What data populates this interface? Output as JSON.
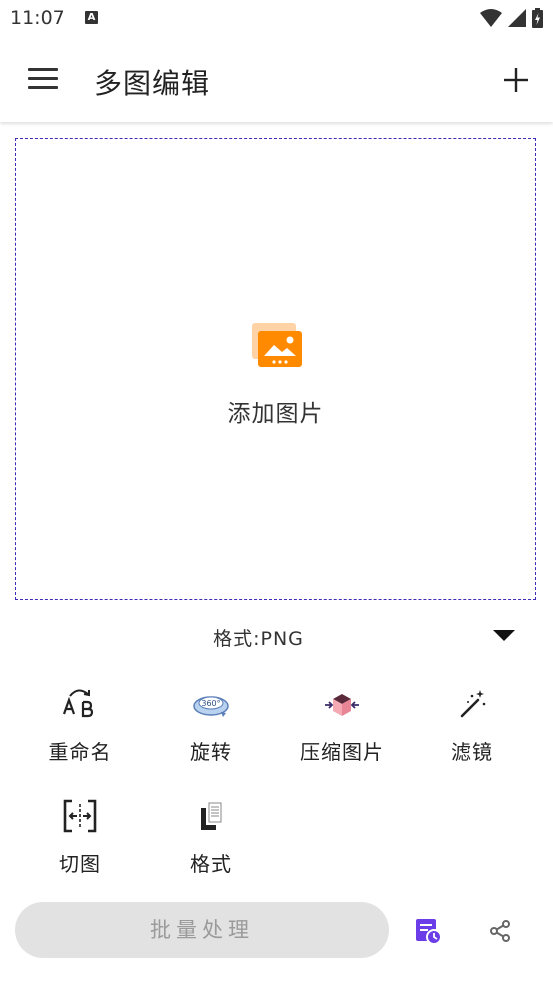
{
  "status_bar": {
    "time": "11:07",
    "notification_icon": "A"
  },
  "app_bar": {
    "title": "多图编辑",
    "menu_icon": "hamburger-menu-icon",
    "add_icon": "plus-icon"
  },
  "drop_zone": {
    "label": "添加图片",
    "icon": "add-image-icon",
    "border_color": "#3b2bb5",
    "icon_color": "#ff8a00"
  },
  "format": {
    "label": "格式:PNG"
  },
  "tools": [
    {
      "label": "重命名",
      "icon": "rename-ab-icon"
    },
    {
      "label": "旋转",
      "icon": "rotate-360-icon"
    },
    {
      "label": "压缩图片",
      "icon": "compress-box-icon"
    },
    {
      "label": "滤镜",
      "icon": "magic-wand-icon"
    },
    {
      "label": "切图",
      "icon": "crop-split-icon"
    },
    {
      "label": "格式",
      "icon": "format-document-icon"
    }
  ],
  "bottom_bar": {
    "batch_button": "批量处理",
    "history_icon": "history-icon",
    "share_icon": "share-icon",
    "accent": "#6a3de8"
  }
}
